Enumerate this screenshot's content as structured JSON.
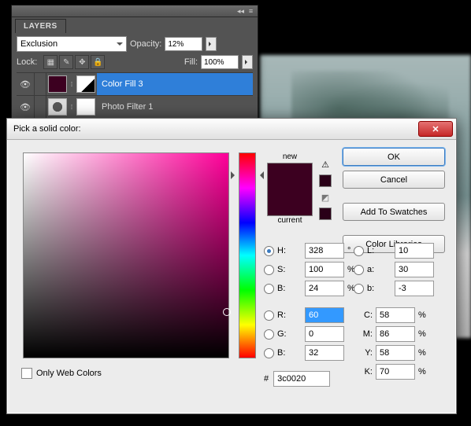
{
  "layers_panel": {
    "tab": "LAYERS",
    "blend_mode": "Exclusion",
    "opacity_label": "Opacity:",
    "opacity_value": "12%",
    "lock_label": "Lock:",
    "fill_label": "Fill:",
    "fill_value": "100%",
    "items": [
      {
        "name": "Color Fill 3",
        "selected": true
      },
      {
        "name": "Photo Filter 1",
        "selected": false
      }
    ]
  },
  "dialog": {
    "title": "Pick a solid color:",
    "new_label": "new",
    "current_label": "current",
    "buttons": {
      "ok": "OK",
      "cancel": "Cancel",
      "swatches": "Add To Swatches",
      "libraries": "Color Libraries"
    },
    "hsb": {
      "h": "328",
      "s": "100",
      "b": "24"
    },
    "rgb": {
      "r": "60",
      "g": "0",
      "b": "32"
    },
    "lab": {
      "l": "10",
      "a": "30",
      "b": "-3"
    },
    "cmyk": {
      "c": "58",
      "m": "86",
      "y": "58",
      "k": "70"
    },
    "hex": "3c0020",
    "only_web": "Only Web Colors",
    "units": {
      "deg": "°",
      "pct": "%"
    },
    "labels": {
      "H": "H:",
      "S": "S:",
      "B": "B:",
      "R": "R:",
      "G": "G:",
      "Bb": "B:",
      "L": "L:",
      "a": "a:",
      "bb": "b:",
      "C": "C:",
      "M": "M:",
      "Y": "Y:",
      "K": "K:",
      "hash": "#"
    }
  }
}
